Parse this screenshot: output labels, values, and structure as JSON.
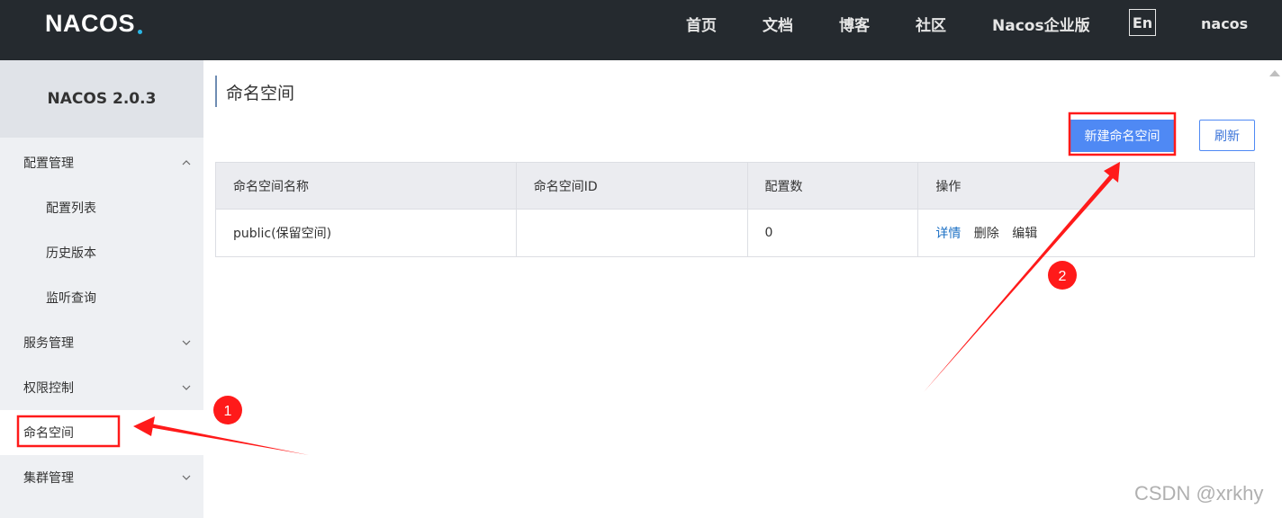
{
  "header": {
    "logo_text": "NACOS",
    "nav": [
      "首页",
      "文档",
      "博客",
      "社区",
      "Nacos企业版"
    ],
    "lang_button": "En",
    "username": "nacos"
  },
  "sidebar": {
    "version": "NACOS 2.0.3",
    "items": [
      {
        "label": "配置管理"
      },
      {
        "label": "配置列表"
      },
      {
        "label": "历史版本"
      },
      {
        "label": "监听查询"
      },
      {
        "label": "服务管理"
      },
      {
        "label": "权限控制"
      },
      {
        "label": "命名空间"
      },
      {
        "label": "集群管理"
      }
    ]
  },
  "main": {
    "title": "命名空间",
    "new_button": "新建命名空间",
    "refresh_button": "刷新",
    "table": {
      "headers": [
        "命名空间名称",
        "命名空间ID",
        "配置数",
        "操作"
      ],
      "rows": [
        {
          "name": "public(保留空间)",
          "id": "",
          "count": "0",
          "ops": [
            "详情",
            "删除",
            "编辑"
          ]
        }
      ]
    }
  },
  "annotations": {
    "step1": "1",
    "step2": "2",
    "color": "#ff1a1a"
  },
  "watermark": "CSDN @xrkhy"
}
